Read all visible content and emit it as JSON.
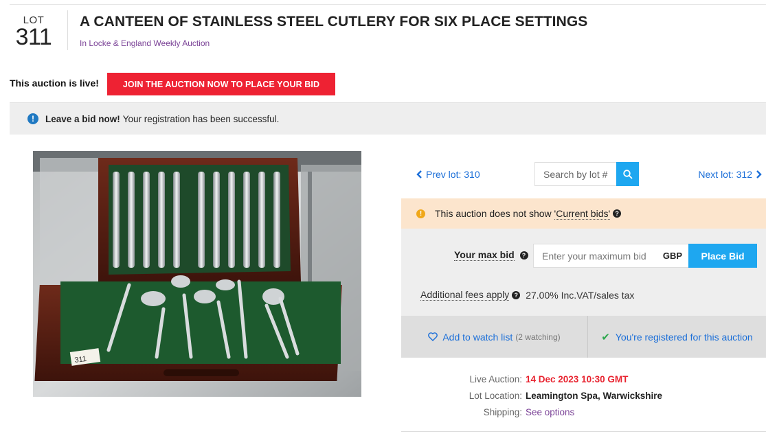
{
  "lot": {
    "label": "LOT",
    "number": "311",
    "title": "A CANTEEN OF STAINLESS STEEL CUTLERY FOR SIX PLACE SETTINGS",
    "auction_link": "In Locke & England Weekly Auction"
  },
  "live": {
    "text": "This auction is live!",
    "join_label": "JOIN THE AUCTION NOW TO PLACE YOUR BID"
  },
  "notice": {
    "bold": "Leave a bid now!",
    "text": "Your registration has been successful."
  },
  "image": {
    "tag_text": "311"
  },
  "nav": {
    "prev_label": "Prev lot: 310",
    "next_label": "Next lot: 312",
    "search_placeholder": "Search by lot #"
  },
  "current_bids": {
    "prefix": "This auction does not show ",
    "link": "'Current bids'"
  },
  "bid": {
    "max_label": "Your max bid",
    "input_placeholder": "Enter your maximum bid",
    "currency": "GBP",
    "place_label": "Place Bid",
    "fees_label": "Additional fees apply",
    "fees_value": "27.00% Inc.VAT/sales tax"
  },
  "actions": {
    "watch_label": "Add to watch list",
    "watch_count": "(2 watching)",
    "registered_label": "You're registered for this auction"
  },
  "info": [
    {
      "key": "Live Auction:",
      "value": "14 Dec 2023 10:30 GMT"
    },
    {
      "key": "Lot Location:",
      "value": "Leamington Spa, Warwickshire"
    },
    {
      "key": "Shipping:",
      "value": "See options"
    }
  ],
  "colors": {
    "accent_red": "#ee2233",
    "link_blue": "#1a6ed8",
    "button_blue": "#1ea7f0",
    "purple_link": "#7b4397",
    "warning_bg": "#fce5cd"
  }
}
